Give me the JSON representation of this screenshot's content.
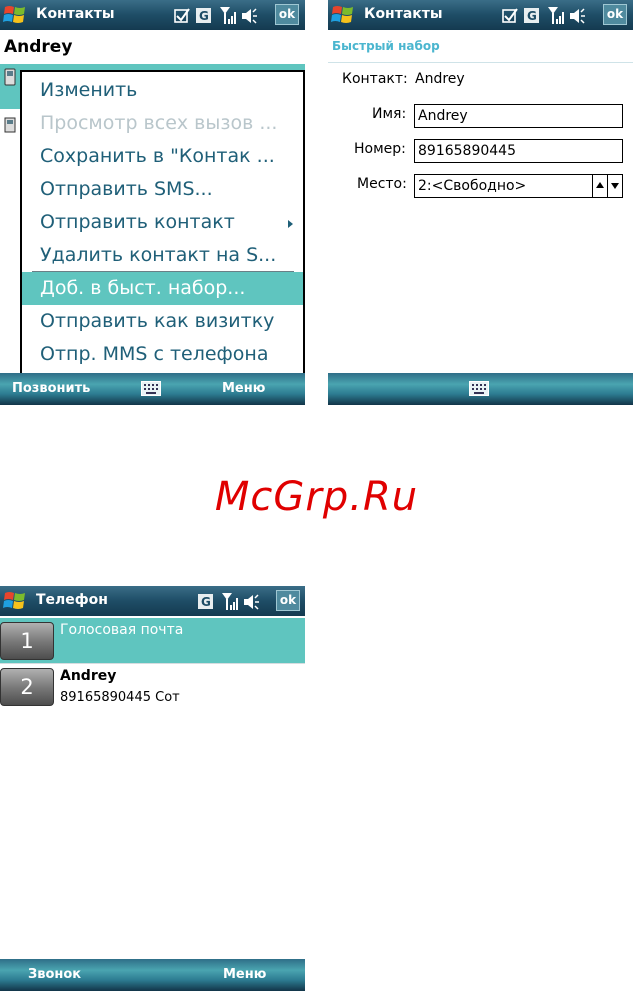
{
  "screen1": {
    "title": "Контакты",
    "ok_label": "ok",
    "contact_name": "Andrey",
    "menu_items": [
      {
        "label": "Изменить",
        "state": "normal"
      },
      {
        "label": "Просмотр всех вызов ...",
        "state": "disabled"
      },
      {
        "label": "Сохранить в \"Контак ...",
        "state": "normal"
      },
      {
        "label": "Отправить SMS...",
        "state": "normal"
      },
      {
        "label": "Отправить контакт",
        "state": "submenu"
      },
      {
        "label": "Удалить контакт на S...",
        "state": "normal"
      },
      {
        "label": "Доб. в быст. набор...",
        "state": "selected"
      },
      {
        "label": "Отправить как визитку",
        "state": "normal"
      },
      {
        "label": "Отпр. MMS с телефона",
        "state": "normal"
      }
    ],
    "softkey_left": "Позвонить",
    "softkey_right": "Меню"
  },
  "screen2": {
    "title": "Контакты",
    "ok_label": "ok",
    "header": "Быстрый набор",
    "contact_label": "Контакт:",
    "contact_value": "Andrey",
    "name_label": "Имя:",
    "name_value": "Andrey",
    "number_label": "Номер:",
    "number_value": "89165890445",
    "place_label": "Место:",
    "place_value": "2:<Свободно>"
  },
  "watermark": "McGrp.Ru",
  "screen3": {
    "title": "Телефон",
    "ok_label": "ok",
    "entries": [
      {
        "num": "1",
        "name": "Голосовая почта",
        "sub": ""
      },
      {
        "num": "2",
        "name": "Andrey",
        "sub": "89165890445 Сот"
      }
    ],
    "softkey_left": "Звонок",
    "softkey_right": "Меню"
  },
  "colors": {
    "accent": "#5fc5bf",
    "menu_text": "#1f5f78",
    "header_text": "#4bb6cf",
    "watermark": "#e00000"
  }
}
